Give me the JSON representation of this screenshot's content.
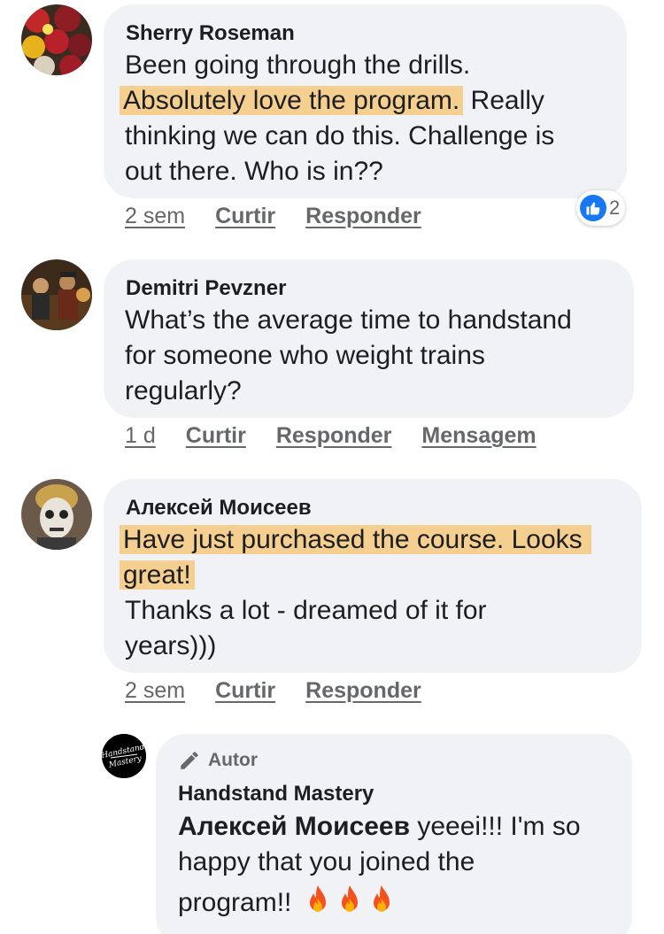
{
  "comments": [
    {
      "author": "Sherry Roseman",
      "lines": [
        {
          "before": "Been going  through  the drills.",
          "highlight": "",
          "after": ""
        },
        {
          "before": "",
          "highlight": "Absolutely  love the program.",
          "after": " Really"
        },
        {
          "before": "thinking  we can do this. Challenge  is",
          "highlight": "",
          "after": ""
        },
        {
          "before": "out there. Who is in??",
          "highlight": "",
          "after": ""
        }
      ],
      "time": "2 sem",
      "like_label": "Curtir",
      "reply_label": "Responder",
      "reactions": {
        "icon": "thumbs-up-icon",
        "count": "2"
      }
    },
    {
      "author": "Demitri Pevzner",
      "lines": [
        "What’s the average time to handstand",
        "for someone who weight trains",
        "regularly?"
      ],
      "time": "1 d",
      "like_label": "Curtir",
      "reply_label": "Responder",
      "message_label": "Mensagem"
    },
    {
      "author": "Алексей Моисеев",
      "highlight_lines": [
        "Have just purchased the course. Looks",
        "great!"
      ],
      "lines": [
        "Thanks a lot - dreamed of it for",
        "years)))"
      ],
      "time": "2 sem",
      "like_label": "Curtir",
      "reply_label": "Responder"
    }
  ],
  "reply": {
    "badge": "Autor",
    "badge_icon": "pencil-icon",
    "author": "Handstand Mastery",
    "avatar_text": [
      "Handstand",
      "Mastery"
    ],
    "mention": "Алексей Моисеев",
    "lines": [
      " yeeei!!! I'm so",
      "happy that you joined the",
      "program!!"
    ],
    "emoji": [
      "fire-icon",
      "fire-icon",
      "fire-icon"
    ]
  },
  "colors": {
    "bubble": "#f0f2f5",
    "highlight": "#f4cf8f",
    "meta_text": "#65676b",
    "like_blue": "#1877f2"
  }
}
